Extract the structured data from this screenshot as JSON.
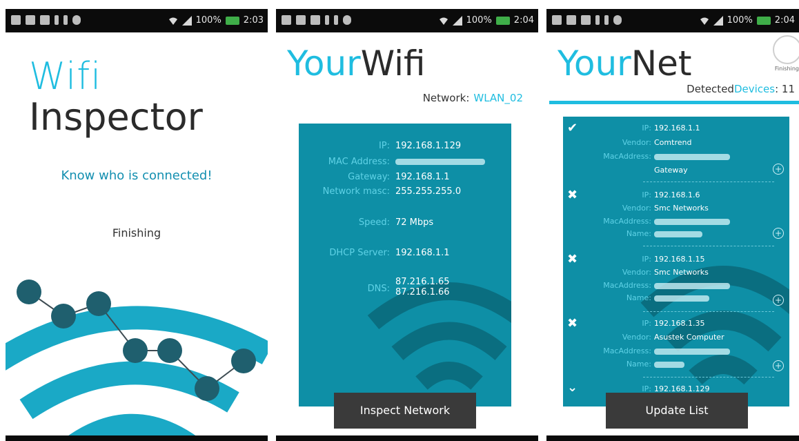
{
  "status_bars": [
    {
      "battery": "100%",
      "time": "2:03"
    },
    {
      "battery": "100%",
      "time": "2:04"
    },
    {
      "battery": "100%",
      "time": "2:04"
    }
  ],
  "screen1": {
    "title_line1": "Wifi",
    "title_line2": "Inspector",
    "tagline": "Know who is connected!",
    "status": "Finishing"
  },
  "screen2": {
    "brand_part1": "Your",
    "brand_part2": "Wifi",
    "network_label": "Network:",
    "network_value": "WLAN_02",
    "rows": [
      {
        "label": "IP:",
        "value": "192.168.1.129"
      },
      {
        "label": "MAC Address:",
        "value": ""
      },
      {
        "label": "Gateway:",
        "value": "192.168.1.1"
      },
      {
        "label": "Network masc:",
        "value": "255.255.255.0"
      },
      {
        "label": "Speed:",
        "value": "72 Mbps"
      },
      {
        "label": "DHCP Server:",
        "value": "192.168.1.1"
      },
      {
        "label": "DNS:",
        "value": "87.216.1.65"
      },
      {
        "label": "",
        "value": "87.216.1.66"
      }
    ],
    "button": "Inspect Network"
  },
  "screen3": {
    "brand_part1": "Your",
    "brand_part2": "Net",
    "status": "Finishing",
    "detected_prefix": "Detected",
    "detected_label": "Devices",
    "detected_count": ": 11",
    "devices": [
      {
        "mark": "✔",
        "ip": "192.168.1.1",
        "vendor": "Comtrend",
        "name": "Gateway"
      },
      {
        "mark": "✖",
        "ip": "192.168.1.6",
        "vendor": "Smc Networks",
        "name": ""
      },
      {
        "mark": "✖",
        "ip": "192.168.1.15",
        "vendor": "Smc Networks",
        "name": ""
      },
      {
        "mark": "✖",
        "ip": "192.168.1.35",
        "vendor": "Asustek Computer",
        "name": ""
      },
      {
        "mark": "⌄",
        "ip": "192.168.1.129",
        "vendor": "",
        "name": ""
      }
    ],
    "labels": {
      "ip": "IP:",
      "vendor": "Vendor:",
      "mac": "MacAddress:",
      "name": "Name:"
    },
    "button": "Update List"
  }
}
